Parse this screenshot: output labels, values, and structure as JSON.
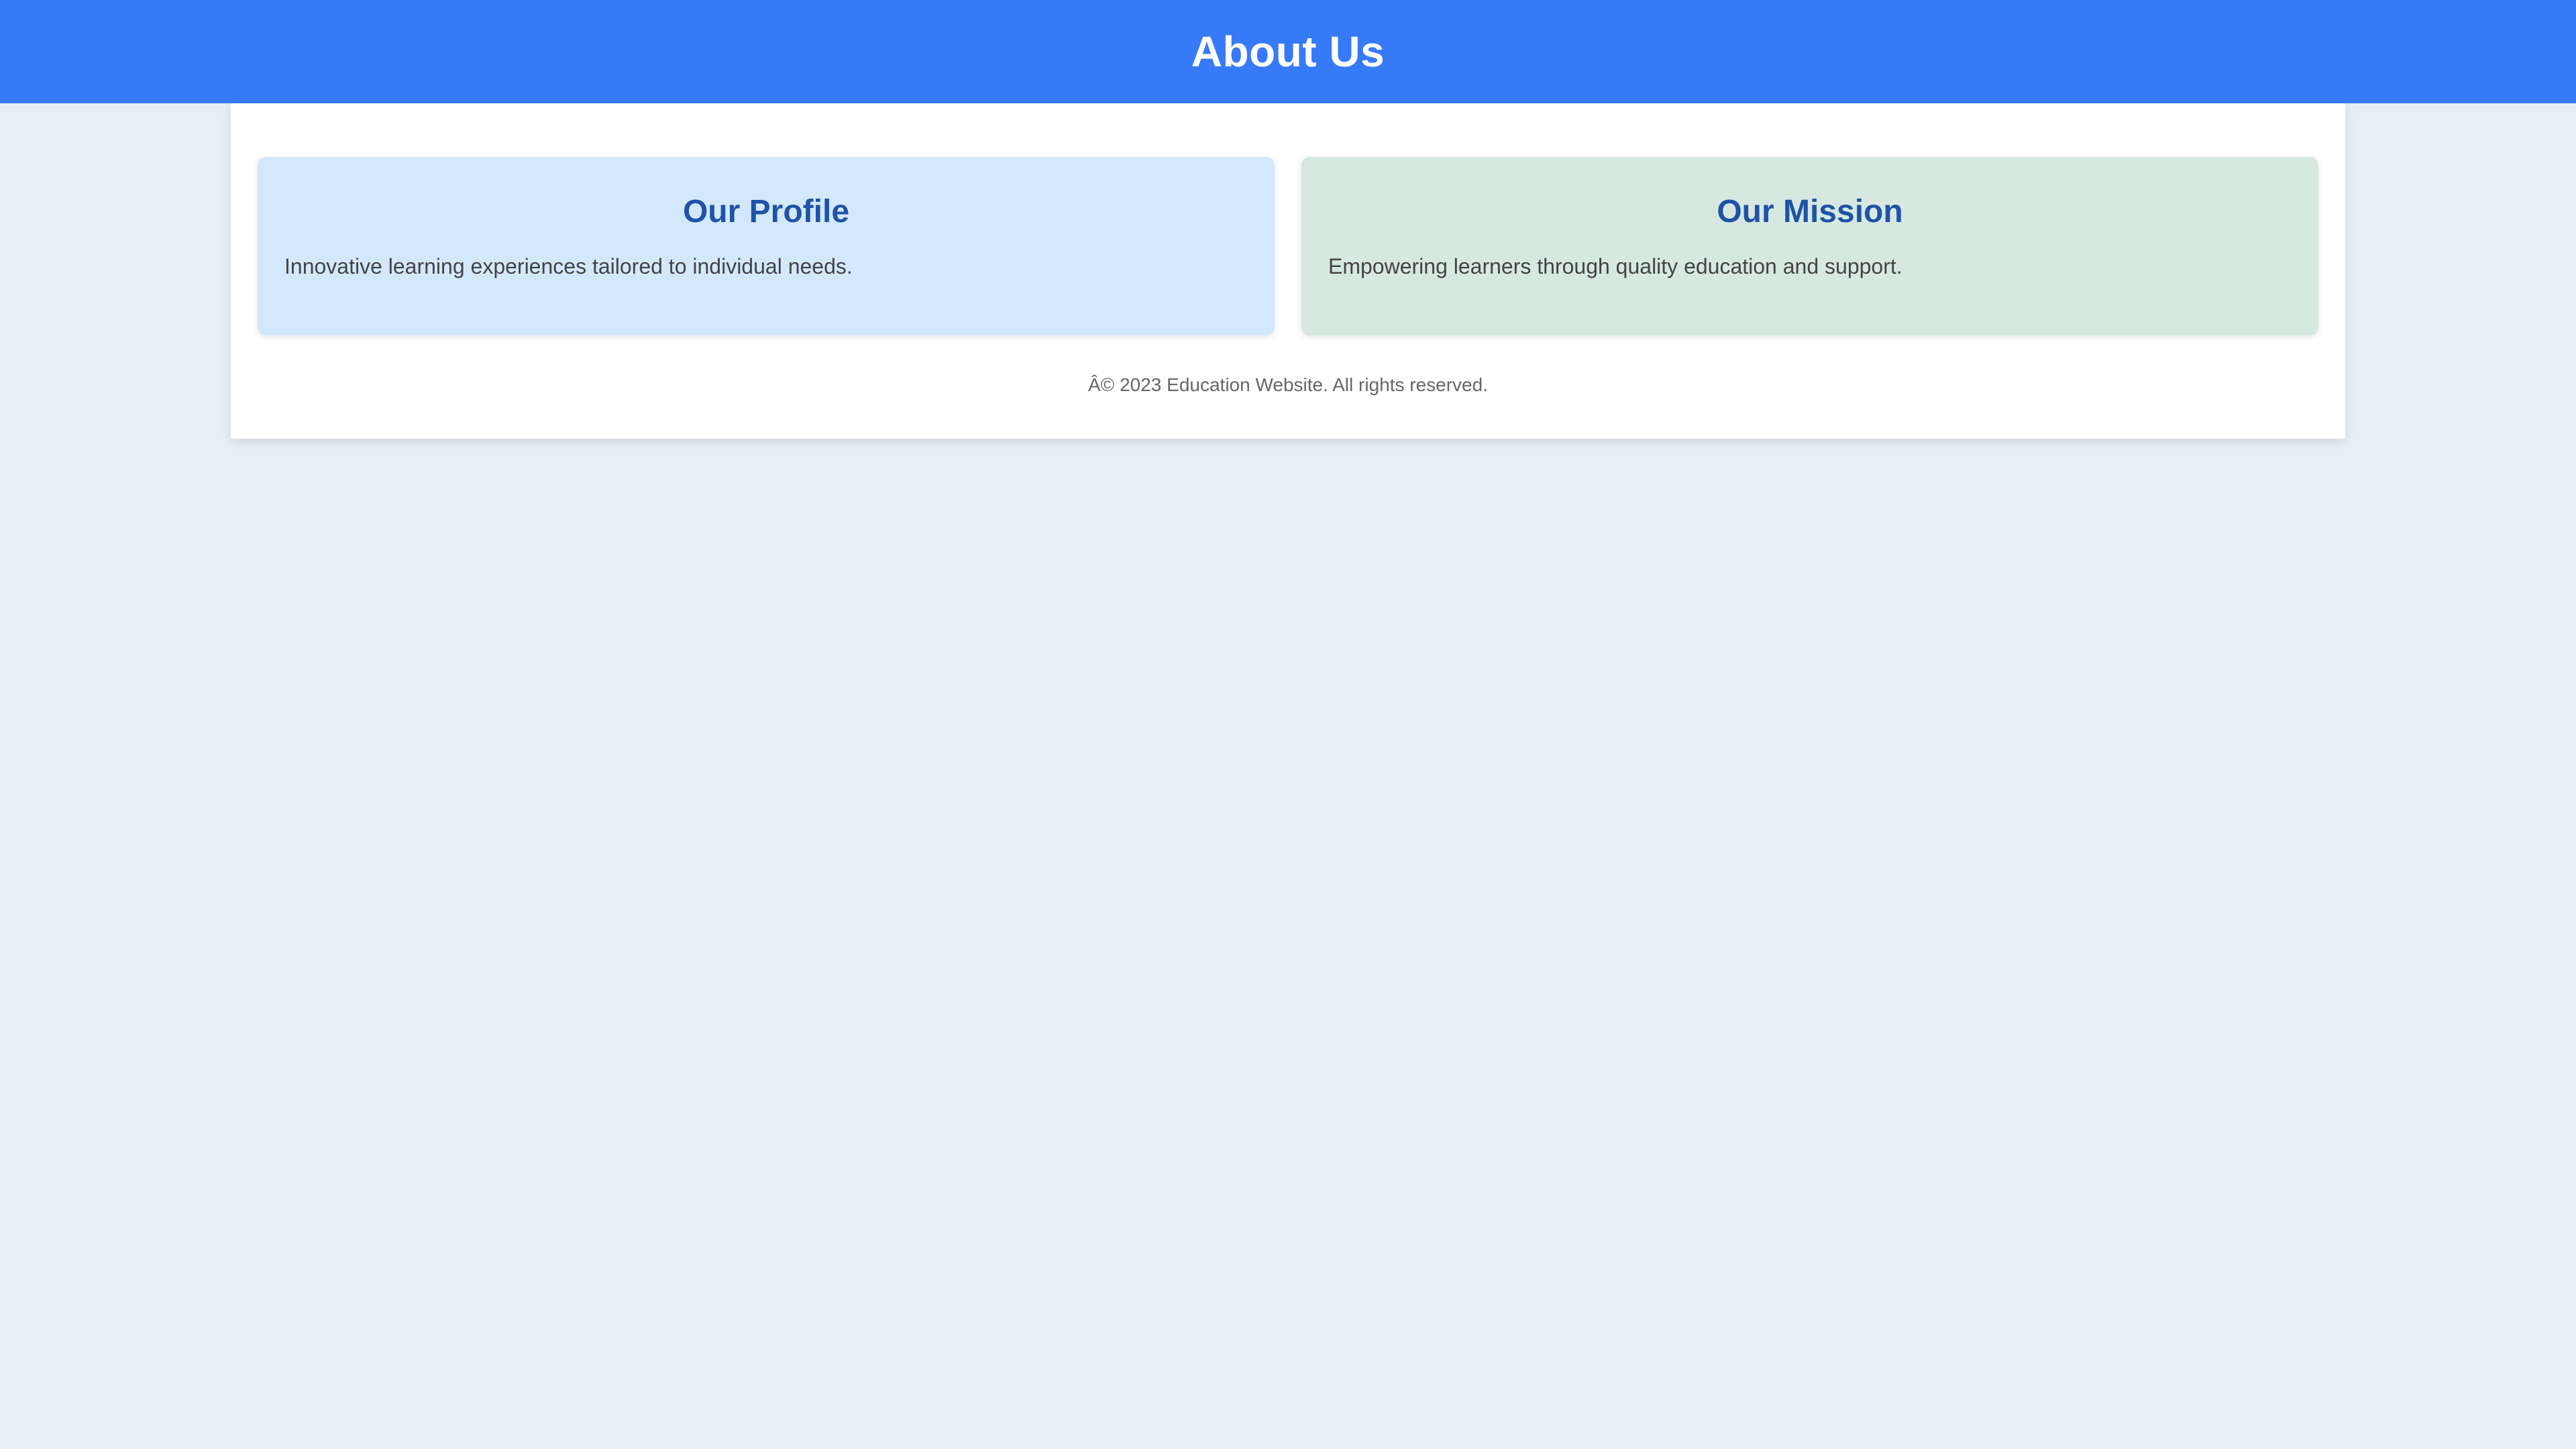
{
  "header": {
    "title": "About Us"
  },
  "cards": [
    {
      "title": "Our Profile",
      "text": "Innovative learning experiences tailored to individual needs."
    },
    {
      "title": "Our Mission",
      "text": "Empowering learners through quality education and support."
    }
  ],
  "footer": {
    "text": "Â© 2023 Education Website. All rights reserved."
  },
  "colors": {
    "header_bg": "#377af7",
    "page_bg": "#e6eef6",
    "profile_card_bg": "#d4e8fc",
    "mission_card_bg": "#d6e8e0",
    "card_title": "#1f53a8"
  }
}
